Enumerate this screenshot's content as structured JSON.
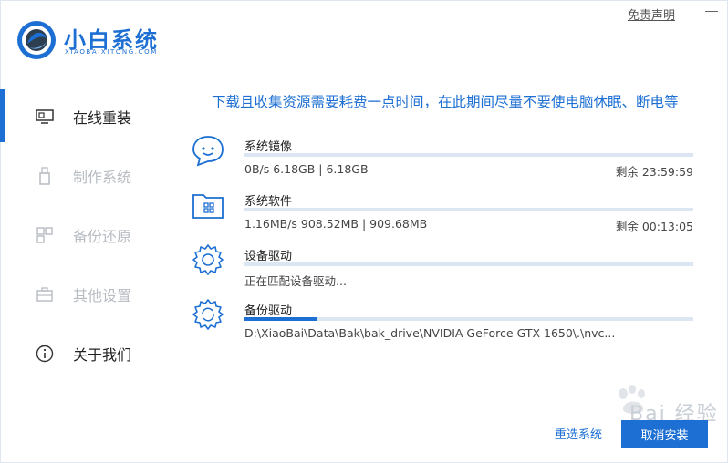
{
  "app": {
    "name": "小白系统",
    "subtitle": "XIAOBAIXITONG.COM",
    "disclaimer": "免责声明"
  },
  "colors": {
    "accent": "#1d6fd3",
    "track": "#dbe6f2",
    "dim": "#b7bcc2"
  },
  "sidebar": {
    "items": [
      {
        "label": "在线重装",
        "icon": "monitor-icon",
        "active": true
      },
      {
        "label": "制作系统",
        "icon": "usb-icon",
        "active": false
      },
      {
        "label": "备份还原",
        "icon": "grid-icon",
        "active": false
      },
      {
        "label": "其他设置",
        "icon": "briefcase-icon",
        "active": false
      },
      {
        "label": "关于我们",
        "icon": "info-icon",
        "active": true
      }
    ]
  },
  "main": {
    "headline": "下载且收集资源需要耗费一点时间，在此期间尽量不要使电脑休眠、断电等",
    "tasks": [
      {
        "title": "系统镜像",
        "detail": "0B/s 6.18GB | 6.18GB",
        "remaining": "剩余 23:59:59",
        "progress": 0,
        "icon": "chat-bubble-icon"
      },
      {
        "title": "系统软件",
        "detail": "1.16MB/s 908.52MB | 909.68MB",
        "remaining": "剩余 00:13:05",
        "progress": 0,
        "icon": "folder-apps-icon"
      },
      {
        "title": "设备驱动",
        "detail": "正在匹配设备驱动...",
        "remaining": "",
        "progress": 0,
        "icon": "gear-icon"
      },
      {
        "title": "备份驱动",
        "detail": "D:\\XiaoBai\\Data\\Bak\\bak_drive\\NVIDIA GeForce GTX 1650\\.\\nvc...",
        "remaining": "",
        "progress": 0.16,
        "icon": "gear-refresh-icon"
      }
    ]
  },
  "buttons": {
    "reselect": "重选系统",
    "cancel": "取消安装"
  },
  "watermark": "Bai 经验"
}
